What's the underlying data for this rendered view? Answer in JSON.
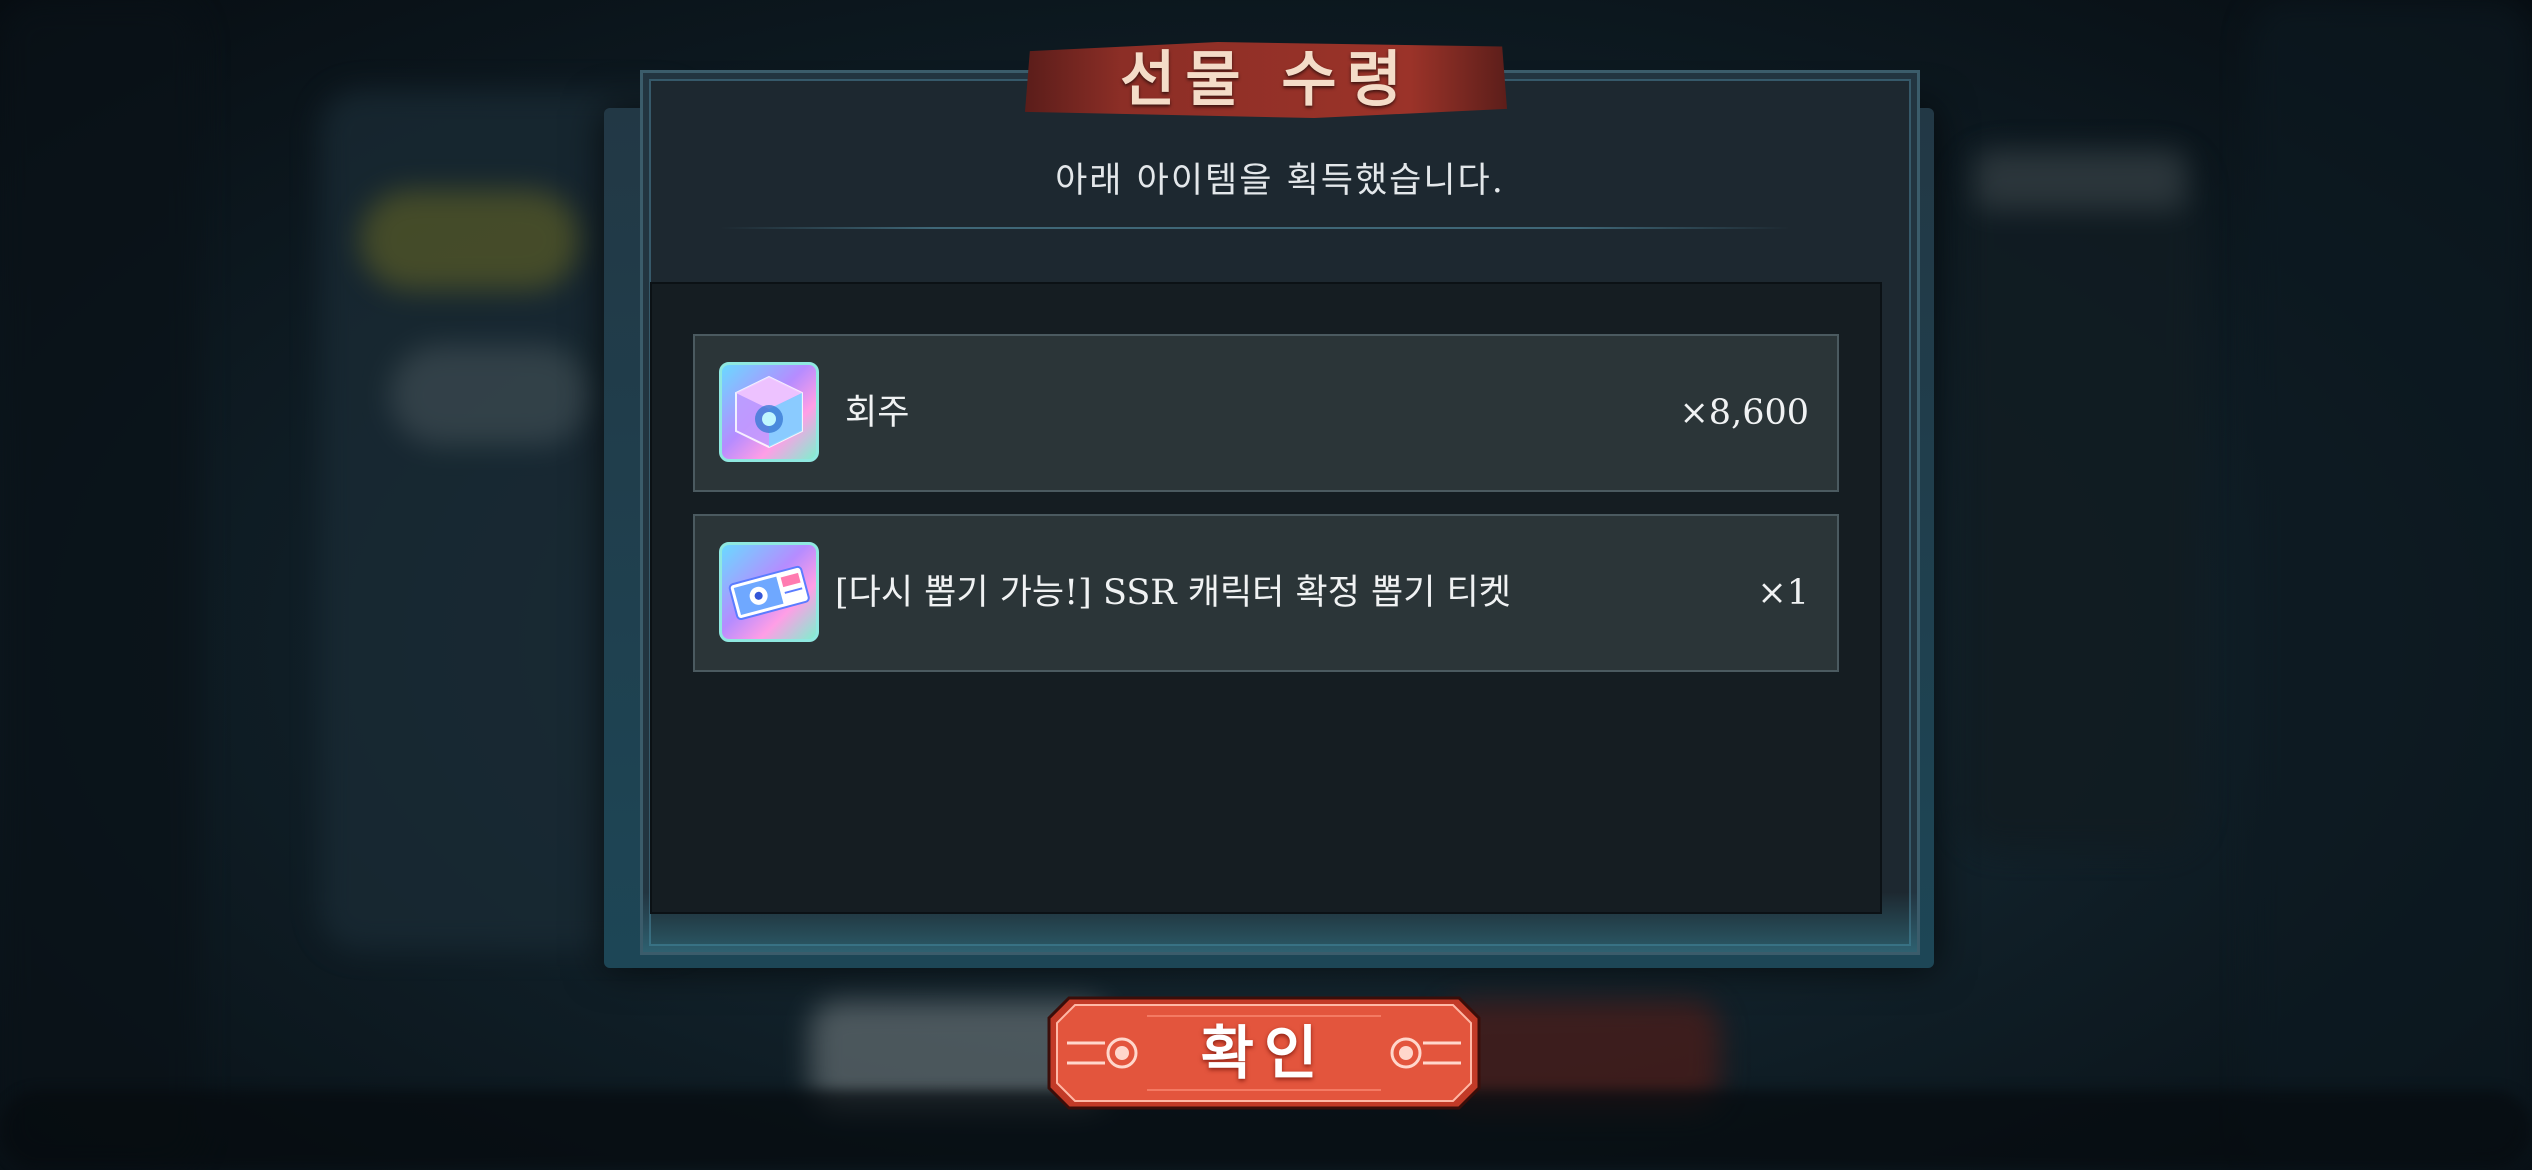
{
  "dialog": {
    "title": "선물 수령",
    "subtitle": "아래 아이템을 획득했습니다.",
    "items": [
      {
        "name": "회주",
        "quantity": "×8,600",
        "icon": "crystal-cube-icon"
      },
      {
        "name": "[다시 뽑기 가능!] SSR 캐릭터 확정 뽑기 티켓",
        "quantity": "×1",
        "icon": "gacha-ticket-icon"
      }
    ],
    "confirm_label": "확인"
  },
  "colors": {
    "title_banner": "#8c2e26",
    "confirm_button": "#e2533c",
    "frame_accent": "#3b5c6b"
  }
}
